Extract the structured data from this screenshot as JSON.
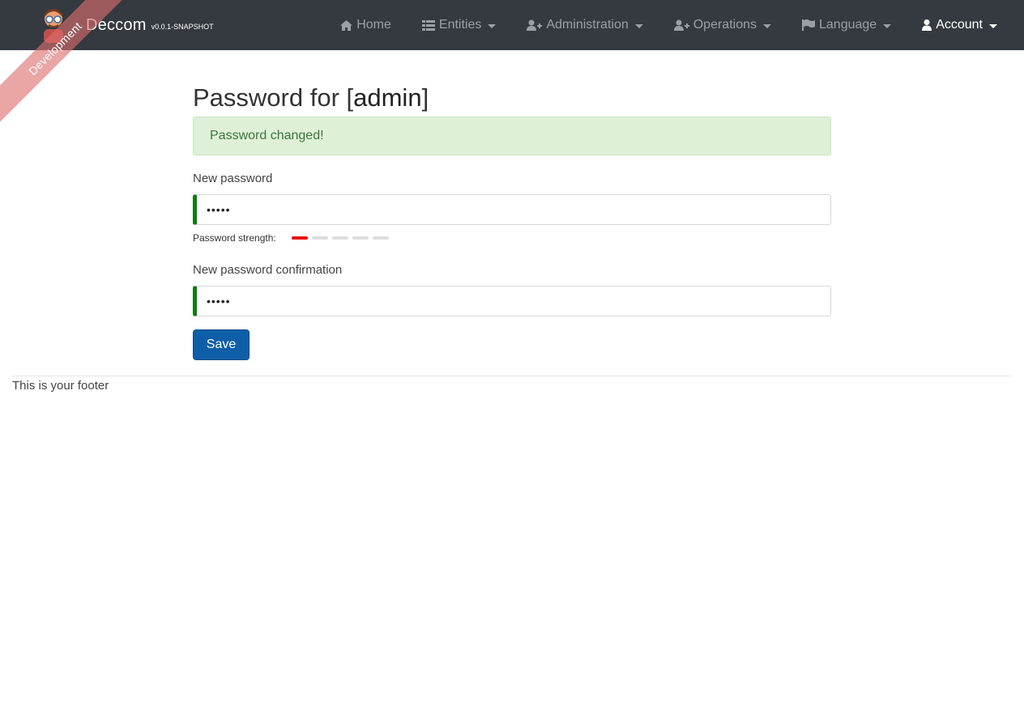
{
  "navbar": {
    "brand_name": "Deccom",
    "version": "v0.0.1-SNAPSHOT",
    "ribbon": "Development",
    "items": [
      {
        "label": "Home",
        "icon": "home-icon",
        "dropdown": false
      },
      {
        "label": "Entities",
        "icon": "list-icon",
        "dropdown": true
      },
      {
        "label": "Administration",
        "icon": "user-plus-icon",
        "dropdown": true
      },
      {
        "label": "Operations",
        "icon": "user-plus-icon",
        "dropdown": true
      },
      {
        "label": "Language",
        "icon": "flag-icon",
        "dropdown": true
      },
      {
        "label": "Account",
        "icon": "user-icon",
        "dropdown": true,
        "active": true
      }
    ]
  },
  "page": {
    "title_prefix": "Password for [",
    "username": "admin",
    "title_suffix": "]",
    "alert": "Password changed!",
    "new_password_label": "New password",
    "new_password_value": "•••••",
    "strength_label": "Password strength:",
    "strength_level": 1,
    "strength_max": 5,
    "confirm_label": "New password confirmation",
    "confirm_value": "•••••",
    "save_label": "Save"
  },
  "footer": {
    "text": "This is your footer"
  },
  "colors": {
    "navbar": "#343a40",
    "alert_bg": "#dff0d8",
    "alert_text": "#3c763d",
    "valid_border": "#107b10",
    "strength_on": "#e8110f",
    "primary": "#0f5fa8"
  }
}
